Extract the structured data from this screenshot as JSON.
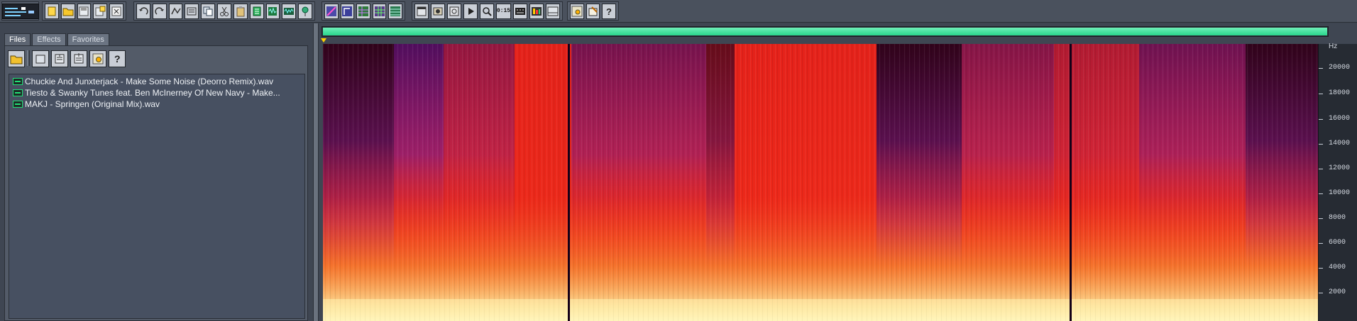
{
  "toolbar": {
    "groups": [
      {
        "name": "file",
        "icons": [
          "new-file-icon",
          "open-folder-icon",
          "save-icon",
          "save-as-icon",
          "close-file-icon"
        ]
      },
      {
        "name": "edit",
        "icons": [
          "undo-icon",
          "redo-icon",
          "repeat-icon",
          "select-all-icon",
          "copy-icon",
          "cut-icon",
          "paste-icon",
          "trim-icon",
          "paste-mix-icon",
          "wave-icon",
          "marker-icon"
        ]
      },
      {
        "name": "view",
        "icons": [
          "waveform-view-icon",
          "spectral-view-icon",
          "multitrack-icon",
          "mixer-icon",
          "grid-icon"
        ]
      },
      {
        "name": "transport",
        "icons": [
          "window-icon",
          "record-icon",
          "scope-icon",
          "play-icon",
          "zoom-icon"
        ]
      },
      {
        "name": "display",
        "icons": [
          "time-display-icon",
          "frequency-icon",
          "meter-icon",
          "panel-icon"
        ]
      },
      {
        "name": "help",
        "icons": [
          "settings-icon",
          "tools-icon",
          "help-icon"
        ]
      }
    ],
    "time_label": "0:15"
  },
  "left_panel": {
    "tabs": [
      "Files",
      "Effects",
      "Favorites"
    ],
    "active_tab": "Files",
    "file_tools": [
      "open-folder-icon",
      "close-file-icon",
      "insert-file-icon",
      "import-file-icon",
      "settings-icon",
      "help-icon"
    ],
    "files": [
      "Chuckie And Junxterjack - Make Some Noise (Deorro Remix).wav",
      "Tiesto & Swanky Tunes feat. Ben McInerney Of New Navy - Make...",
      "MAKJ - Springen (Original Mix).wav"
    ]
  },
  "spectral_view": {
    "unit": "Hz",
    "frequency_labels": [
      "20000",
      "18000",
      "16000",
      "14000",
      "12000",
      "10000",
      "8000",
      "6000",
      "4000",
      "2000"
    ],
    "colors": {
      "overview": "#29d58c",
      "low_energy": "#140018",
      "high_energy": "#fff4a6",
      "cursor": "#ffd100"
    }
  }
}
